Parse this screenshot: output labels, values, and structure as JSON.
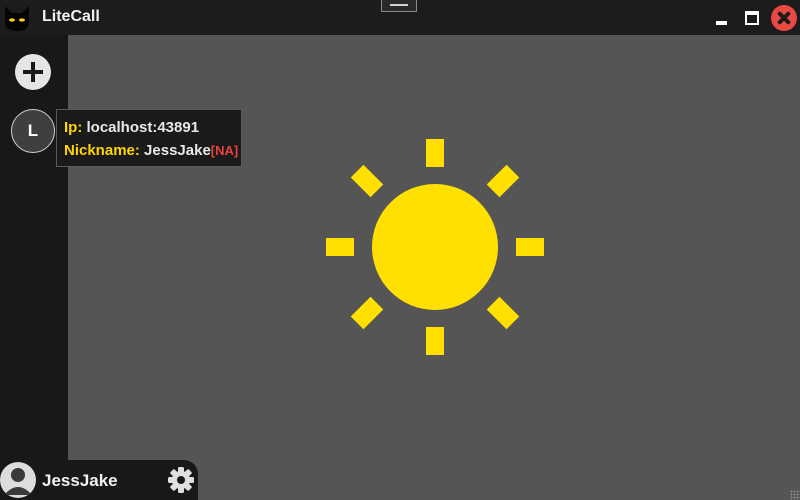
{
  "app": {
    "title": "LiteCall",
    "logo_icon": "cat-face-icon"
  },
  "window_controls": {
    "minimize_icon": "minimize-icon",
    "maximize_icon": "maximize-icon",
    "close_icon": "close-icon",
    "close_color": "#e84a43"
  },
  "sidebar": {
    "add_icon": "plus-icon",
    "contacts": [
      {
        "initial": "L"
      }
    ]
  },
  "tooltip": {
    "ip_label": "Ip:",
    "ip_value": "localhost:43891",
    "nickname_label": "Nickname:",
    "nickname_value": "JessJake",
    "status_tag": "[NA]"
  },
  "user": {
    "name": "JessJake",
    "avatar_icon": "user-avatar-icon",
    "settings_icon": "gear-icon"
  },
  "main": {
    "status_icon": "sun-icon",
    "accent": "#ffe000"
  }
}
